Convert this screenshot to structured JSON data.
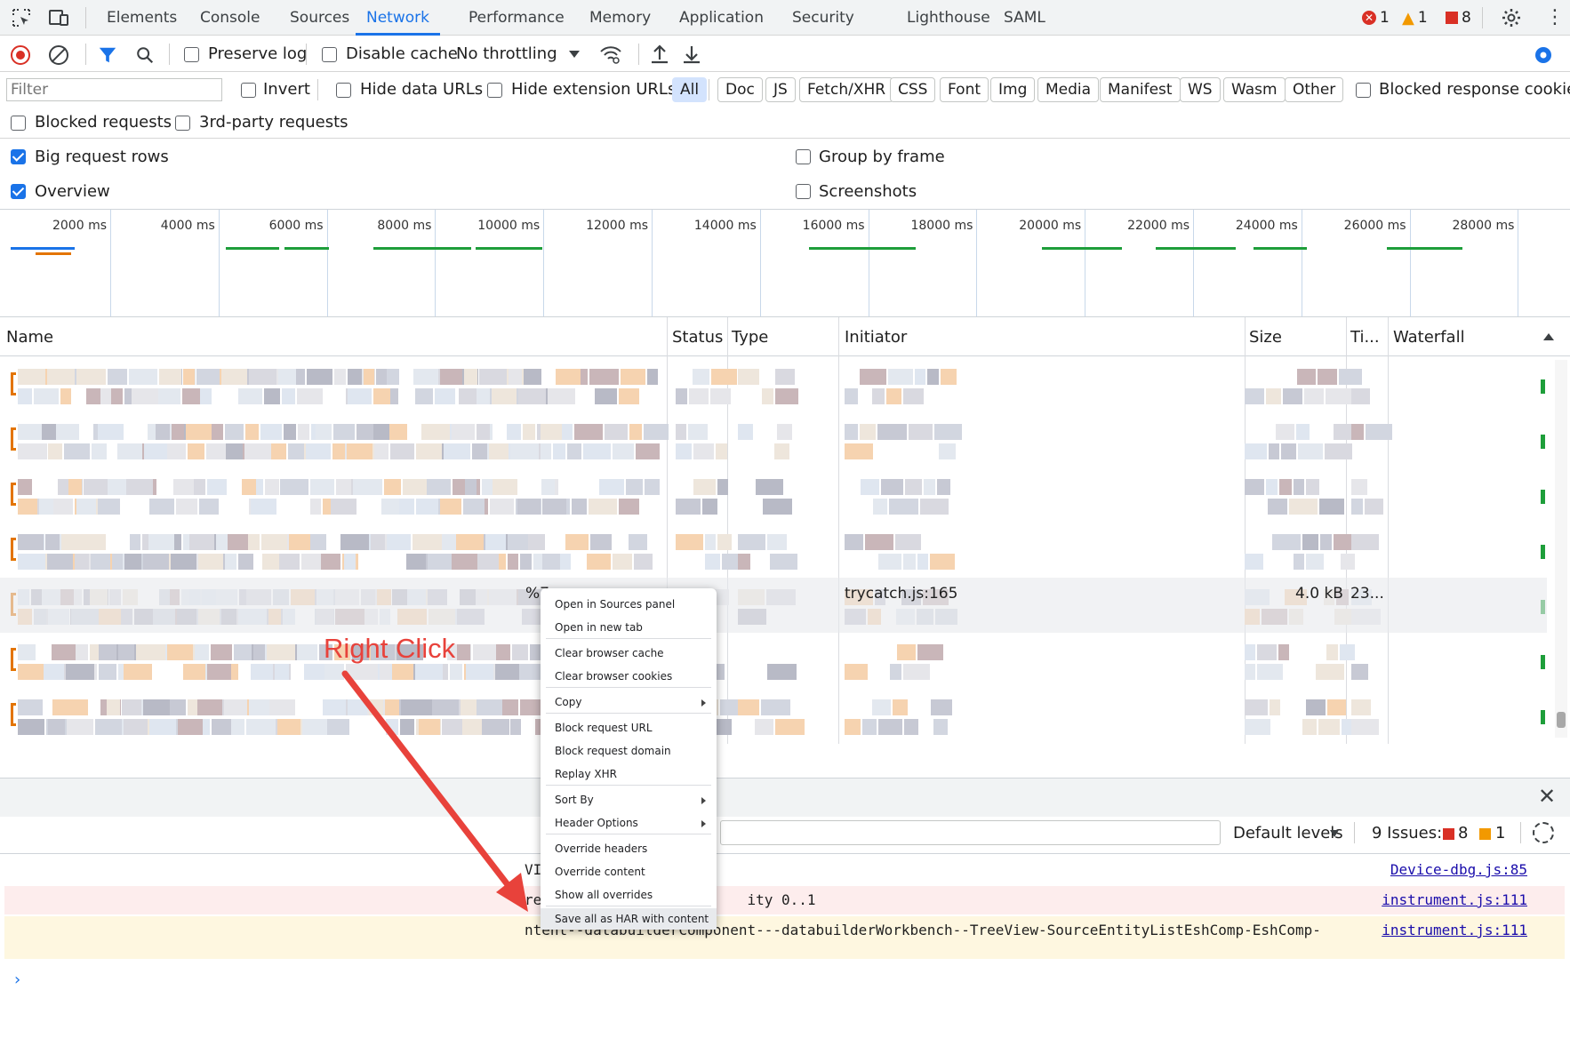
{
  "tabs": [
    {
      "label": "Elements"
    },
    {
      "label": "Console"
    },
    {
      "label": "Sources"
    },
    {
      "label": "Network"
    },
    {
      "label": "Performance"
    },
    {
      "label": "Memory"
    },
    {
      "label": "Application"
    },
    {
      "label": "Security"
    },
    {
      "label": "Lighthouse"
    },
    {
      "label": "SAML"
    }
  ],
  "active_tab": "Network",
  "counts": {
    "errors": "1",
    "warnings": "1",
    "issues": "8"
  },
  "toolbar": {
    "preserve_log": "Preserve log",
    "disable_cache": "Disable cache",
    "throttling": "No throttling"
  },
  "filter": {
    "placeholder": "Filter",
    "invert": "Invert",
    "hide_data_urls": "Hide data URLs",
    "hide_extension_urls": "Hide extension URLs",
    "types": [
      "All",
      "Doc",
      "JS",
      "Fetch/XHR",
      "CSS",
      "Font",
      "Img",
      "Media",
      "Manifest",
      "WS",
      "Wasm",
      "Other"
    ],
    "blocked_response_cookies": "Blocked response cookies",
    "blocked_requests": "Blocked requests",
    "third_party": "3rd-party requests"
  },
  "settings": {
    "big_rows": "Big request rows",
    "overview": "Overview",
    "group_by_frame": "Group by frame",
    "screenshots": "Screenshots"
  },
  "overview_ticks": [
    "2000 ms",
    "4000 ms",
    "6000 ms",
    "8000 ms",
    "10000 ms",
    "12000 ms",
    "14000 ms",
    "16000 ms",
    "18000 ms",
    "20000 ms",
    "22000 ms",
    "24000 ms",
    "26000 ms",
    "28000 ms"
  ],
  "columns": {
    "name": "Name",
    "status": "Status",
    "type": "Type",
    "initiator": "Initiator",
    "size": "Size",
    "time": "Ti...",
    "waterfall": "Waterfall"
  },
  "selected_row": {
    "name_suffix": "%7",
    "initiator": "trycatch.js:165",
    "size": "4.0 kB",
    "time": "23..."
  },
  "context_menu": [
    {
      "label": "Open in Sources panel"
    },
    {
      "label": "Open in new tab"
    },
    {
      "label": "Clear browser cache"
    },
    {
      "label": "Clear browser cookies"
    },
    {
      "label": "Copy"
    },
    {
      "label": "Block request URL"
    },
    {
      "label": "Block request domain"
    },
    {
      "label": "Replay XHR"
    },
    {
      "label": "Sort By"
    },
    {
      "label": "Header Options"
    },
    {
      "label": "Override headers"
    },
    {
      "label": "Override content"
    },
    {
      "label": "Show all overrides"
    },
    {
      "label": "Save all as HAR with content"
    }
  ],
  "annotation": "Right Click",
  "console": {
    "default_levels": "Default levels",
    "issues_label": "9 Issues:",
    "issues_errors": "8",
    "issues_warnings": "1",
    "messages": [
      {
        "text": "VI",
        "source": "Device-dbg.js:85"
      },
      {
        "text": "re                        ity 0..1",
        "source": "instrument.js:111"
      },
      {
        "text": "ntent--databuilderComponent---databuilderWorkbench--TreeView-SourceEntityListEshComp-EshComp-",
        "source": "instrument.js:111"
      }
    ]
  },
  "colors": {
    "accent": "#1a73e8",
    "error": "#d93025",
    "warning": "#f29900",
    "annotation": "#e8423b"
  }
}
